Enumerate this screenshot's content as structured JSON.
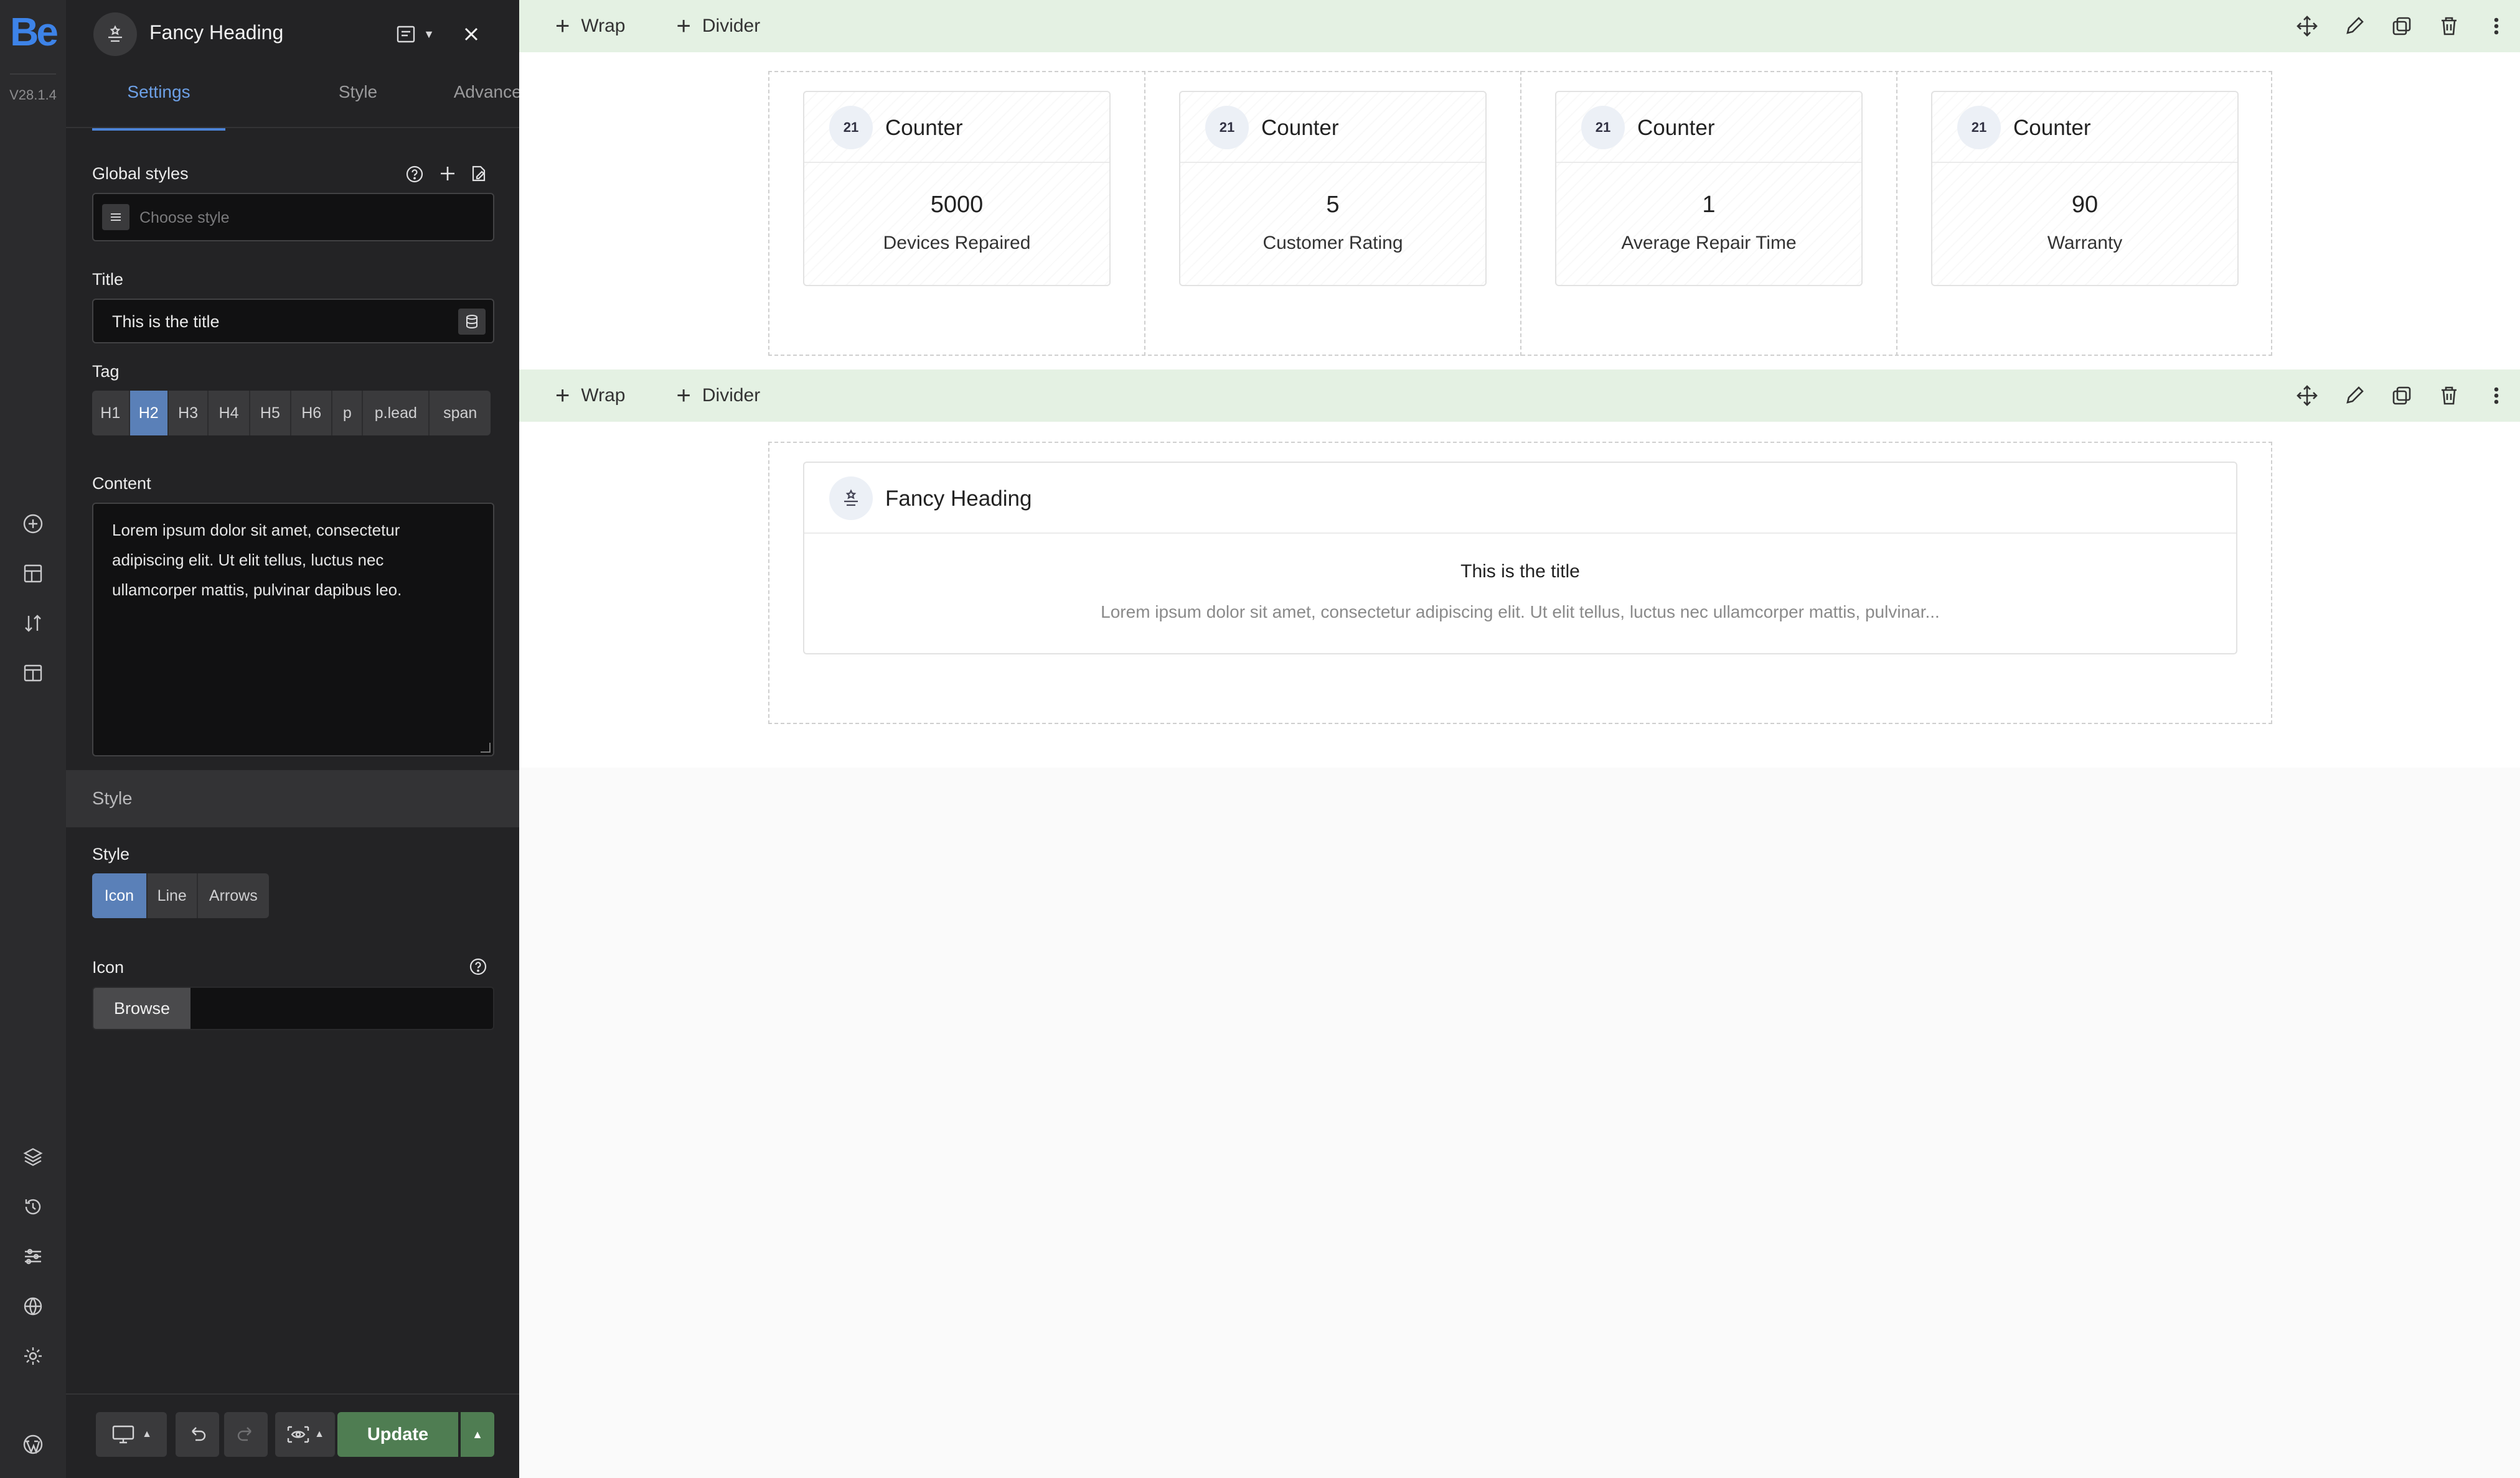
{
  "rail": {
    "logo": "Be",
    "version": "V28.1.4"
  },
  "panel": {
    "element_title": "Fancy Heading",
    "tabs": [
      {
        "label": "Settings",
        "active": true
      },
      {
        "label": "Style",
        "active": false
      },
      {
        "label": "Advanced",
        "active": false
      }
    ],
    "global_styles": {
      "label": "Global styles",
      "placeholder": "Choose style"
    },
    "title_field": {
      "label": "Title",
      "value": "This is the title"
    },
    "tag": {
      "label": "Tag",
      "options": [
        "H1",
        "H2",
        "H3",
        "H4",
        "H5",
        "H6",
        "p",
        "p.lead",
        "span"
      ],
      "selected": "H2"
    },
    "content": {
      "label": "Content",
      "value": "Lorem ipsum dolor sit amet, consectetur adipiscing elit. Ut elit tellus, luctus nec ullamcorper mattis, pulvinar dapibus leo."
    },
    "style_section": {
      "heading": "Style",
      "style_label": "Style",
      "style_options": [
        "Icon",
        "Line",
        "Arrows"
      ],
      "style_selected": "Icon",
      "icon_label": "Icon",
      "browse_label": "Browse"
    },
    "footer": {
      "update_label": "Update"
    }
  },
  "canvas": {
    "toolbars": [
      {
        "wrap_label": "Wrap",
        "divider_label": "Divider"
      },
      {
        "wrap_label": "Wrap",
        "divider_label": "Divider"
      }
    ],
    "counters": [
      {
        "badge": "21",
        "title": "Counter",
        "value": "5000",
        "caption": "Devices Repaired"
      },
      {
        "badge": "21",
        "title": "Counter",
        "value": "5",
        "caption": "Customer Rating"
      },
      {
        "badge": "21",
        "title": "Counter",
        "value": "1",
        "caption": "Average Repair Time"
      },
      {
        "badge": "21",
        "title": "Counter",
        "value": "90",
        "caption": "Warranty"
      }
    ],
    "fancy_heading_card": {
      "title": "Fancy Heading",
      "heading": "This is the title",
      "excerpt": "Lorem ipsum dolor sit amet, consectetur adipiscing elit. Ut elit tellus, luctus nec ullamcorper mattis, pulvinar..."
    }
  },
  "colors": {
    "accent": "#4c83d6",
    "update_green": "#4f7d52",
    "toolbar_green": "#e4f1e3"
  }
}
